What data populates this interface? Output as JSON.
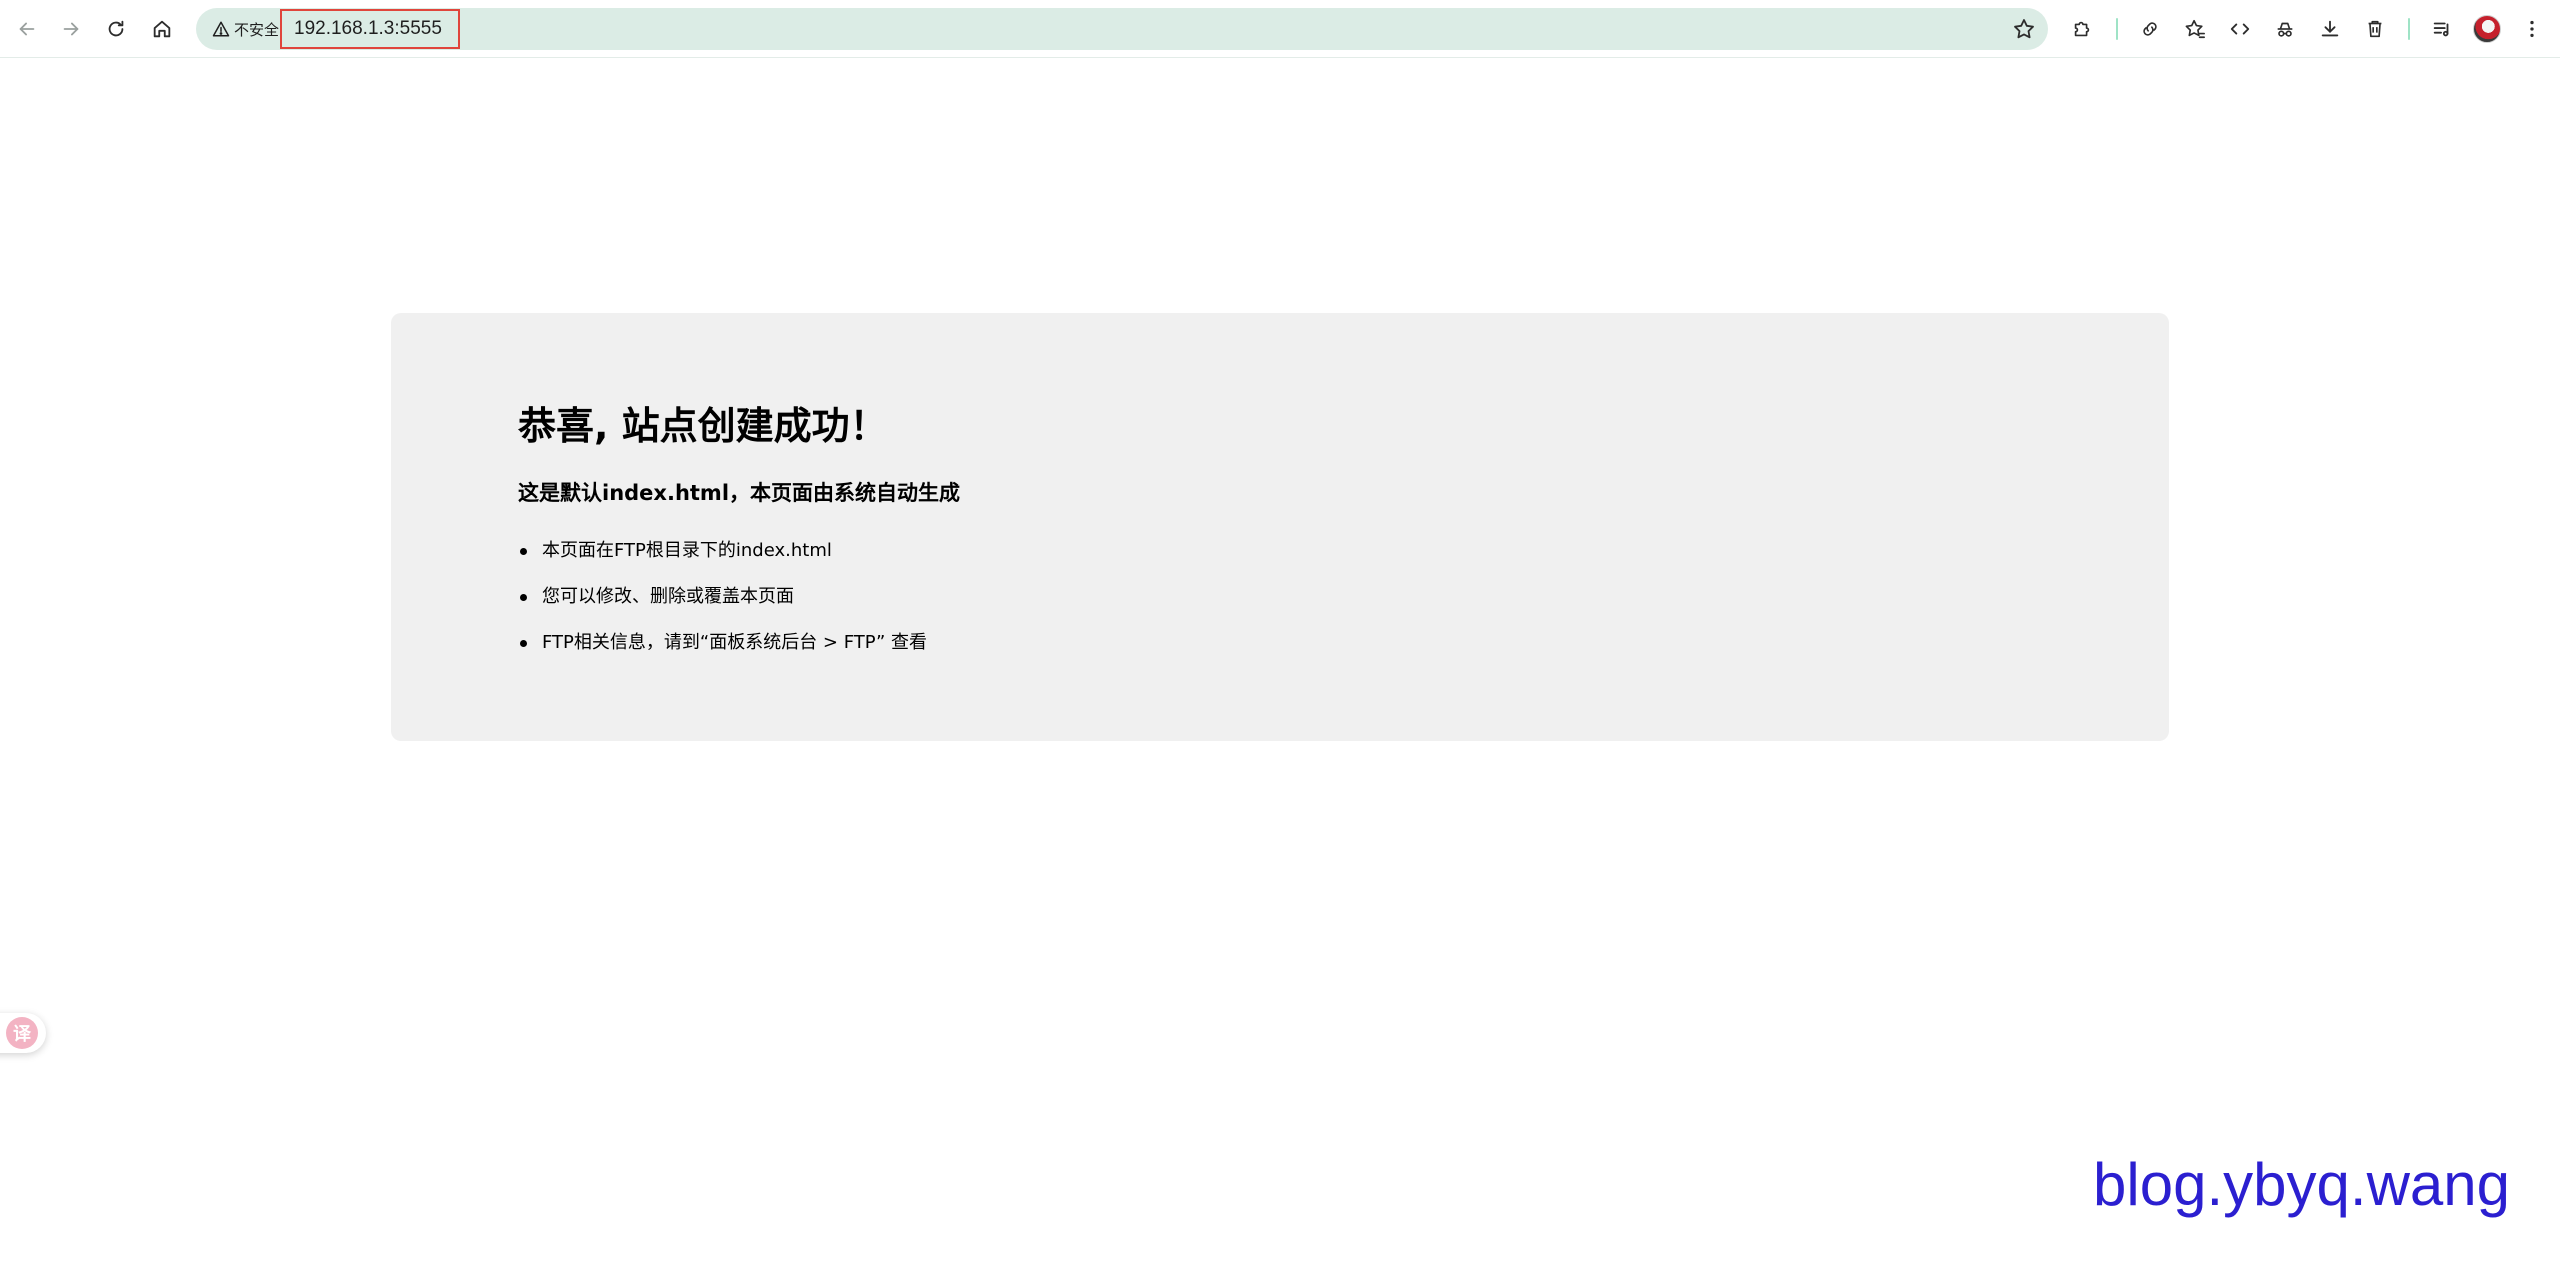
{
  "browser": {
    "security_text": "不安全",
    "url": "192.168.1.3:5555",
    "icons": {
      "back": "back-arrow-icon",
      "forward": "forward-arrow-icon",
      "reload": "reload-icon",
      "home": "home-icon",
      "warning": "warning-triangle-icon",
      "bookmark": "star-icon",
      "extensions": "puzzle-icon",
      "link": "link-icon",
      "bookmarks": "star-list-icon",
      "devtools": "code-icon",
      "incognito": "incognito-icon",
      "download": "download-icon",
      "delete": "trash-icon",
      "media": "media-queue-icon",
      "menu": "kebab-menu-icon"
    },
    "colors": {
      "omnibox_bg": "#dbece5",
      "highlight_border": "#e0453c",
      "divider": "#9fe3c6"
    }
  },
  "page": {
    "heading": "恭喜, 站点创建成功！",
    "subheading": "这是默认index.html，本页面由系统自动生成",
    "items": [
      "本页面在FTP根目录下的index.html",
      "您可以修改、删除或覆盖本页面",
      "FTP相关信息，请到“面板系统后台 > FTP” 查看"
    ],
    "card_bg": "#f0f0f0"
  },
  "floating_widget": {
    "glyph": "译",
    "color": "#f3b3c3"
  },
  "watermark": {
    "text": "blog.ybyq.wang",
    "color": "#2b1fd0"
  }
}
